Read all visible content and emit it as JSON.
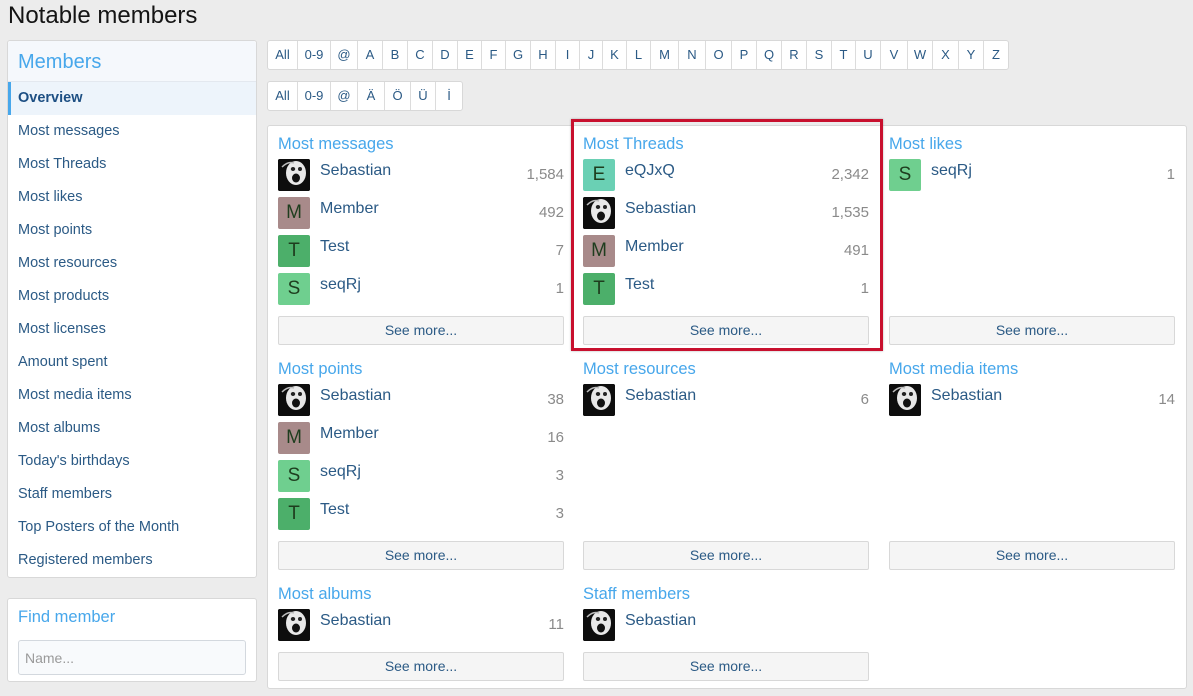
{
  "page": {
    "title": "Notable members"
  },
  "sidebar": {
    "header": "Members",
    "items": [
      {
        "label": "Overview",
        "active": true
      },
      {
        "label": "Most messages"
      },
      {
        "label": "Most Threads"
      },
      {
        "label": "Most likes"
      },
      {
        "label": "Most points"
      },
      {
        "label": "Most resources"
      },
      {
        "label": "Most products"
      },
      {
        "label": "Most licenses"
      },
      {
        "label": "Amount spent"
      },
      {
        "label": "Most media items"
      },
      {
        "label": "Most albums"
      },
      {
        "label": "Today's birthdays"
      },
      {
        "label": "Staff members"
      },
      {
        "label": "Top Posters of the Month"
      },
      {
        "label": "Registered members"
      }
    ]
  },
  "find_member": {
    "title": "Find member",
    "placeholder": "Name..."
  },
  "filters": {
    "row1": [
      "All",
      "0-9",
      "@",
      "A",
      "B",
      "C",
      "D",
      "E",
      "F",
      "G",
      "H",
      "I",
      "J",
      "K",
      "L",
      "M",
      "N",
      "O",
      "P",
      "Q",
      "R",
      "S",
      "T",
      "U",
      "V",
      "W",
      "X",
      "Y",
      "Z"
    ],
    "row2": [
      "All",
      "0-9",
      "@",
      "Ä",
      "Ö",
      "Ü",
      "İ"
    ]
  },
  "blocks": {
    "most_messages": {
      "title": "Most messages",
      "members": [
        {
          "name": "Sebastian",
          "count": "1,584",
          "avatar": "photo"
        },
        {
          "name": "Member",
          "count": "492",
          "avatar": "M"
        },
        {
          "name": "Test",
          "count": "7",
          "avatar": "T"
        },
        {
          "name": "seqRj",
          "count": "1",
          "avatar": "S"
        }
      ],
      "see_more": "See more..."
    },
    "most_threads": {
      "title": "Most Threads",
      "members": [
        {
          "name": "eQJxQ",
          "count": "2,342",
          "avatar": "E"
        },
        {
          "name": "Sebastian",
          "count": "1,535",
          "avatar": "photo"
        },
        {
          "name": "Member",
          "count": "491",
          "avatar": "M"
        },
        {
          "name": "Test",
          "count": "1",
          "avatar": "T"
        }
      ],
      "see_more": "See more..."
    },
    "most_likes": {
      "title": "Most likes",
      "members": [
        {
          "name": "seqRj",
          "count": "1",
          "avatar": "S"
        }
      ],
      "see_more": "See more..."
    },
    "most_points": {
      "title": "Most points",
      "members": [
        {
          "name": "Sebastian",
          "count": "38",
          "avatar": "photo"
        },
        {
          "name": "Member",
          "count": "16",
          "avatar": "M"
        },
        {
          "name": "seqRj",
          "count": "3",
          "avatar": "S"
        },
        {
          "name": "Test",
          "count": "3",
          "avatar": "T"
        }
      ],
      "see_more": "See more..."
    },
    "most_resources": {
      "title": "Most resources",
      "members": [
        {
          "name": "Sebastian",
          "count": "6",
          "avatar": "photo"
        }
      ],
      "see_more": "See more..."
    },
    "most_media_items": {
      "title": "Most media items",
      "members": [
        {
          "name": "Sebastian",
          "count": "14",
          "avatar": "photo"
        }
      ],
      "see_more": "See more..."
    },
    "most_albums": {
      "title": "Most albums",
      "members": [
        {
          "name": "Sebastian",
          "count": "11",
          "avatar": "photo"
        }
      ],
      "see_more": "See more..."
    },
    "staff_members": {
      "title": "Staff members",
      "members": [
        {
          "name": "Sebastian",
          "count": "",
          "avatar": "photo"
        }
      ],
      "see_more": "See more..."
    }
  },
  "colors": {
    "accent": "#47a7eb",
    "link": "#2b5a85",
    "highlight_border": "#c8102e",
    "avatar_M": "#a88a8a",
    "avatar_T": "#4caf6a",
    "avatar_S": "#6fcf8f",
    "avatar_E": "#6ad0b4"
  }
}
